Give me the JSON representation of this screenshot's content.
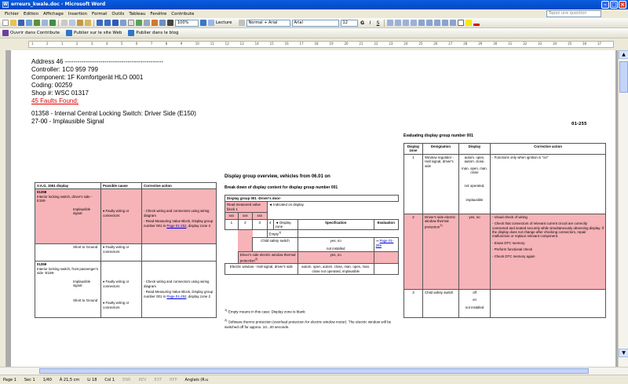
{
  "window": {
    "title": "erreurs_kwale.doc - Microsoft Word",
    "app_icon": "W"
  },
  "menu": [
    "Fichier",
    "Edition",
    "Affichage",
    "Insertion",
    "Format",
    "Outils",
    "Tableau",
    "Fenêtre",
    "Contribute"
  ],
  "help_placeholder": "Tapez une question",
  "toolbar": {
    "zoom": "100%",
    "read_label": "Lecture",
    "style": "Normal + Arial",
    "font": "Arial",
    "size": "12"
  },
  "contribute": {
    "edit_label": "Ouvrir dans Contribute",
    "publish_web_label": "Publier sur le site Web",
    "publish_blog_label": "Publier dans le blog"
  },
  "ruler_ticks": [
    "1",
    "2",
    "1",
    "2",
    "3",
    "4",
    "5",
    "6",
    "7",
    "8",
    "9",
    "10",
    "11",
    "12",
    "13",
    "14",
    "15",
    "16",
    "17",
    "18",
    "19",
    "20",
    "21",
    "22",
    "23",
    "24",
    "25",
    "26",
    "27",
    "28",
    "29",
    "30",
    "31",
    "32",
    "33",
    "34",
    "35",
    "36",
    "37"
  ],
  "doc": {
    "address": "Address 46 -----------------------------------------------",
    "controller": "Controller: 1C0 959 799",
    "component": "Component: 1F Komfortgerät HLO 0001",
    "coding": "Coding: 00259",
    "shop": "Shop #: WSC 01317",
    "faults": "45 Faults Found:",
    "fault_line1": "01358 - Internal Central Locking Switch: Driver Side (E150)",
    "fault_line2": "27-00 - Implausible Signal",
    "page_ref": "01-255"
  },
  "vag": {
    "headers": [
      "V.A.G. 1551 display",
      "Possible cause",
      "Corrective action"
    ],
    "code1": "01358",
    "desc1": "Interior locking switch, driver's side -E150-",
    "implausible": "Implausible signal",
    "faulty": "Faulty wiring or connectors",
    "check": "Check wiring and connectors using wiring diagram",
    "read1": "Read Measuring Value Block, Display group number 001",
    "in_label": "in",
    "page_link": "Page 01-252",
    "zone3": ", display zone 3",
    "short": "Short to Ground",
    "code2": "01359",
    "desc2": "Interior locking switch, front passenger's side -E159-",
    "read2": "Read Measuring Value Block, Display group number 001",
    "zone2": ", display zone 2"
  },
  "overview": {
    "title": "Display group overview, vehicles from 06.01 on",
    "breakdown": "Break down of display content for display group number 001",
    "group_title": "Display group 001 -Driver's door-",
    "read_block": "Read measured value block 1",
    "indicated": "Indicated on display",
    "xxx": "xxx",
    "zones": [
      "1",
      "2",
      "3",
      "4"
    ],
    "display_zone": "Display zone",
    "empty": "Empty",
    "spec_header": "Specification",
    "eval_header": "Evaluation",
    "child_switch": "Child safety switch",
    "yes_no": "yes, no",
    "not_installed": "not installed",
    "eval_link": "Page 01-255",
    "thermal": "Driver's side electric window thermal protection",
    "hall": "Electric window - Hall signal, driver's side",
    "hall_spec": "autom. open, autom. close, man. open, man. close not operated, implausible",
    "fn1": "Empty means in this case: Display zone is blank",
    "fn2": "Software thermo protection (overload protection for electric window motor). The electric window will be switched off for approx. 10...20 seconds."
  },
  "evaluating": {
    "title": "Evaluating display group number 001",
    "headers": [
      "Display zone",
      "Designation",
      "Display",
      "Corrective action"
    ],
    "z1": "1",
    "z1_desig": "Window regulator - Hall signal, driver's side",
    "z1_disp": [
      "autom. open, autom. close,",
      "man. open, man. close",
      "not operated,",
      "implausible"
    ],
    "z1_action": "Functions only when ignition is \"on\"",
    "z2": "2",
    "z2_desig": "Driver's side electric window thermal protection",
    "z2_disp": "yes, no",
    "z2_actions": [
      "Visual check of wiring",
      "Check that connectors of relevant current circuit are correctly connected and seated securely while simultaneously observing display. If the display does not change after checking connectors, repair malfunction or replace relevant component.",
      "Erase DTC memory",
      "Perform functional check",
      "Check DTC memory again"
    ],
    "z3": "3",
    "z3_desig": "Child safety switch",
    "z3_disp": [
      "off",
      "on",
      "not installed"
    ]
  },
  "status": {
    "page": "Page 1",
    "sec": "Sec 1",
    "pages": "1/40",
    "at": "À 21,5 cm",
    "line": "Li 18",
    "col": "Col 1",
    "rec": "ENR",
    "rev": "REV",
    "ext": "EXT",
    "ovr": "RFP",
    "lang": "Anglais (R.u"
  },
  "colors": {
    "title_bar": "#0a5de0",
    "highlight_pink": "#f6b3b8",
    "fault_red": "#d00000",
    "link": "#0000cc"
  }
}
